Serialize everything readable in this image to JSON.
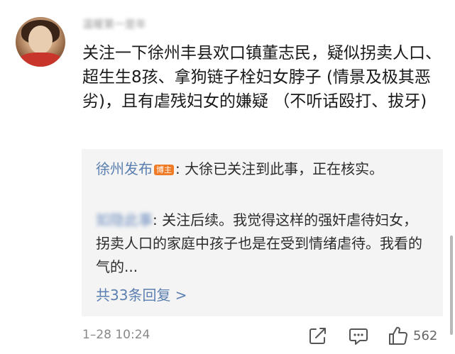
{
  "post": {
    "username": "温暖第一是年",
    "comment_text": "关注一下徐州丰县欢口镇董志民，疑似拐卖人口、超生生8孩、拿狗链子栓妇女脖子 (情景及极其恶劣)，且有虐残妇女的嫌疑 （不听话殴打、拔牙)",
    "timestamp": "1–28 10:24",
    "like_count": "562"
  },
  "replies": [
    {
      "name": "徐州发布",
      "badge": "博主",
      "text": ": 大徐已关注到此事，正在核实。"
    },
    {
      "name": "如隐此事",
      "text": ": 关注后续。我觉得这样的强奸虐待妇女，拐卖人口的家庭中孩子也是在受到情绪虐待。我看的气的..."
    }
  ],
  "more_replies_label": "共33条回复 >",
  "icons": {
    "share": "share-icon",
    "comment": "comment-icon",
    "like": "thumbs-up-icon"
  },
  "colors": {
    "link_blue": "#5a7fb0",
    "badge_orange": "#f07b27",
    "reply_bg": "#f4f4f4"
  }
}
